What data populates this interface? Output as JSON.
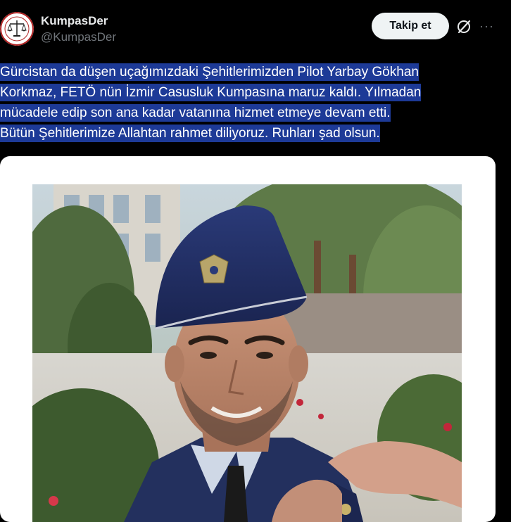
{
  "header": {
    "display_name": "KumpasDer",
    "handle": "@KumpasDer",
    "follow_label": "Takip et",
    "more_label": "···"
  },
  "avatar": {
    "icon": "scales-of-justice-logo"
  },
  "tweet": {
    "lines": [
      "Gürcistan da düşen uçağımızdaki Şehitlerimizden Pilot Yarbay Gökhan",
      "Korkmaz, FETÖ nün İzmir Casusluk Kumpasına maruz kaldı. Yılmadan",
      "mücadele edip son ana kadar vatanına hizmet etmeye devam etti.",
      "Bütün Şehitlerimize Allahtan rahmet diliyoruz. Ruhları şad olsun."
    ]
  },
  "colors": {
    "background": "#000000",
    "highlight": "#1d3a97",
    "follow_button": "#eff3f4",
    "secondary_text": "#71767b"
  }
}
